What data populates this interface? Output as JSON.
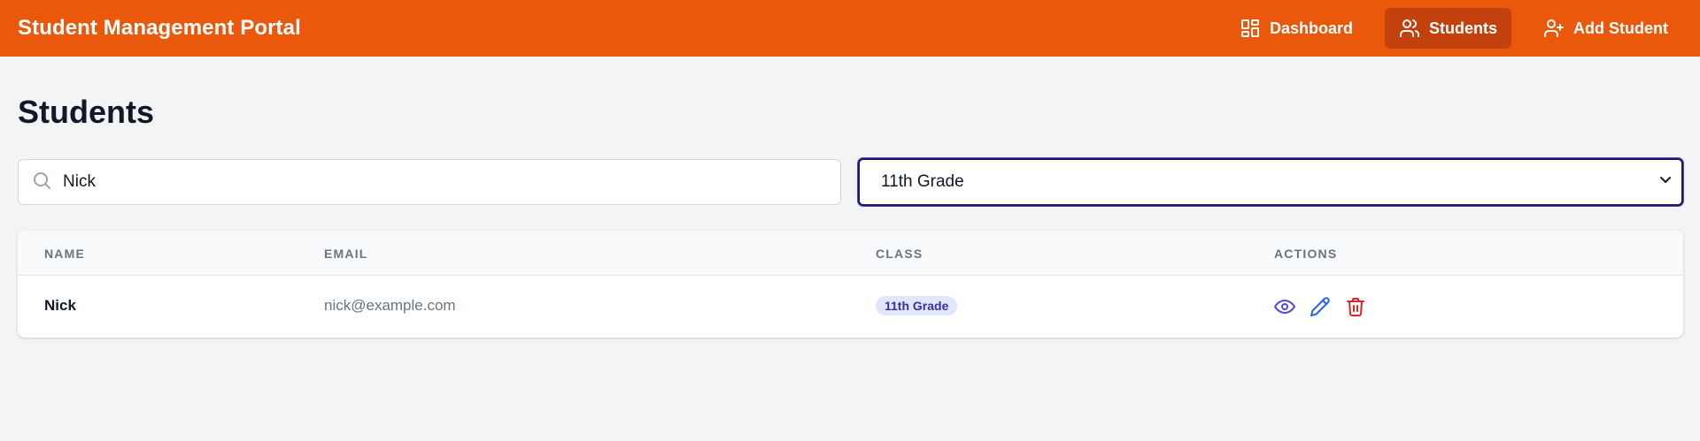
{
  "app": {
    "title": "Student Management Portal",
    "brand_color": "#ea580c",
    "active_nav_color": "#c2410c"
  },
  "nav": {
    "items": [
      {
        "label": "Dashboard",
        "icon": "dashboard-grid-icon",
        "active": false
      },
      {
        "label": "Students",
        "icon": "users-icon",
        "active": true
      },
      {
        "label": "Add Student",
        "icon": "user-plus-icon",
        "active": false
      }
    ]
  },
  "page": {
    "title": "Students"
  },
  "filters": {
    "search": {
      "value": "Nick",
      "icon": "search-icon"
    },
    "class_select": {
      "selected": "11th Grade",
      "icon": "chevron-down-icon"
    }
  },
  "table": {
    "columns": [
      "Name",
      "Email",
      "Class",
      "Actions"
    ],
    "rows": [
      {
        "name": "Nick",
        "email": "nick@example.com",
        "class": "11th Grade",
        "actions": [
          "eye-icon",
          "pencil-icon",
          "trash-icon"
        ]
      }
    ]
  },
  "colors": {
    "view_action": "#4f46e5",
    "edit_action": "#2563eb",
    "delete_action": "#dc2626",
    "badge_bg": "#e0e7ff",
    "badge_text": "#3730a3"
  }
}
